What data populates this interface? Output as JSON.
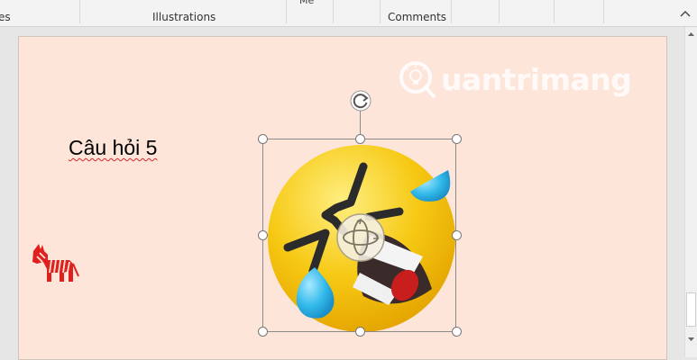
{
  "ribbon": {
    "groups": {
      "prev_partial": "es",
      "illustrations": "Illustrations",
      "cut_off_top": "Mé",
      "comments": "Comments"
    }
  },
  "slide": {
    "text": "Câu hỏi 5",
    "watermark": "uantrimang",
    "watermark_brand": "Quantrimang"
  },
  "icons": {
    "zebra": "zebra-icon",
    "emoji": "rolling-on-floor-laughing-emoji",
    "rotate": "rotate-handle-icon",
    "move3d": "3d-rotate-handle-icon"
  },
  "colors": {
    "slide_bg": "#fde5d9",
    "zebra": "#e0201e",
    "emoji_yellow": "#f5c400",
    "tear_blue": "#2fb6e8"
  }
}
